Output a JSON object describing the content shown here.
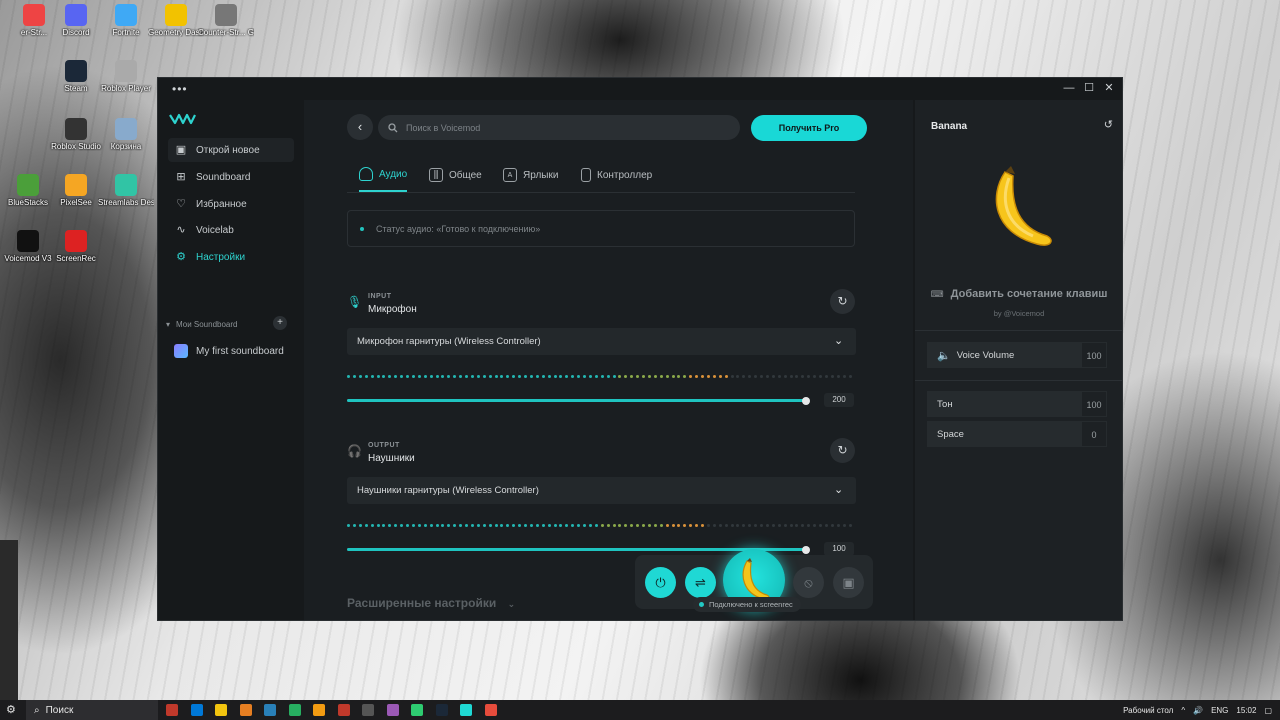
{
  "desktop": {
    "icons": [
      {
        "label": "er-Str..."
      },
      {
        "label": "Discord"
      },
      {
        "label": "Fortnite"
      },
      {
        "label": "Geometry Dash"
      },
      {
        "label": "Counter-Str... Global Offe..."
      },
      {
        "label": "Steam"
      },
      {
        "label": "Roblox Player"
      },
      {
        "label": "Roblox Studio"
      },
      {
        "label": "Корзина"
      },
      {
        "label": "BlueStacks"
      },
      {
        "label": "PixelSee"
      },
      {
        "label": "Streamlabs Desktop"
      },
      {
        "label": "Voicemod V3"
      },
      {
        "label": "ScreenRec"
      }
    ]
  },
  "window": {
    "menu_dots": "•••",
    "controls": {
      "minimize": "—",
      "maximize": "☐",
      "close": "✕"
    }
  },
  "sidebar": {
    "items": [
      {
        "label": "Открой новое",
        "icon": "discover-icon"
      },
      {
        "label": "Soundboard",
        "icon": "grid-plus-icon"
      },
      {
        "label": "Избранное",
        "icon": "heart-icon"
      },
      {
        "label": "Voicelab",
        "icon": "wave-icon"
      },
      {
        "label": "Настройки",
        "icon": "gear-icon"
      }
    ],
    "section_label": "Мои Soundboard",
    "add_symbol": "+",
    "soundboards": [
      {
        "label": "My first soundboard"
      }
    ]
  },
  "header": {
    "search_placeholder": "Поиск в Voicemod",
    "pro_button": "Получить Pro"
  },
  "tabs": [
    {
      "label": "Аудио",
      "active": true
    },
    {
      "label": "Общее",
      "active": false
    },
    {
      "label": "Ярлыки",
      "active": false
    },
    {
      "label": "Контроллер",
      "active": false
    }
  ],
  "status": {
    "text": "Статус аудио: «Готово к подключению»"
  },
  "input": {
    "kicker": "INPUT",
    "title": "Микрофон",
    "device": "Микрофон гарнитуры (Wireless Controller)",
    "value": "200",
    "level": 1.0
  },
  "output": {
    "kicker": "OUTPUT",
    "title": "Наушники",
    "device": "Наушники гарнитуры (Wireless Controller)",
    "value": "100",
    "level": 1.0
  },
  "advanced_label": "Расширенные настройки",
  "connection_pill": "Подключено к screenrec",
  "right_panel": {
    "title": "Banana",
    "hotkey_label": "Добавить сочетание клавиш",
    "by": "by @Voicemod",
    "voice_volume_label": "Voice Volume",
    "voice_volume_value": "100",
    "params": [
      {
        "label": "Тон",
        "value": "100"
      },
      {
        "label": "Space",
        "value": "0"
      }
    ]
  },
  "taskbar": {
    "search": "Поиск",
    "desktop_label": "Рабочий стол",
    "lang": "ENG",
    "time": "15:02"
  },
  "colors": {
    "accent": "#1fd8d4",
    "bg": "#16191b",
    "panel": "#1d2124"
  }
}
